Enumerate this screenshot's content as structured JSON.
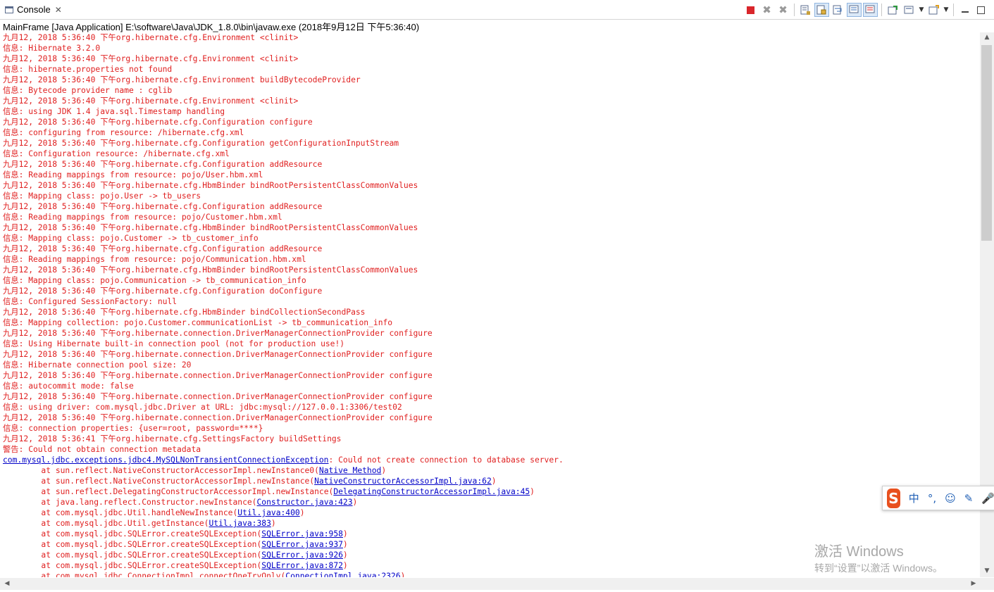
{
  "tab": {
    "label": "Console"
  },
  "process_line": "MainFrame [Java Application] E:\\software\\Java\\JDK_1.8.0\\bin\\javaw.exe (2018年9月12日 下午5:36:40)",
  "colors": {
    "error_text": "#e02020",
    "link_text": "#0000c8",
    "terminate_red": "#d9262b"
  },
  "toolbar_icons": [
    "terminate-icon",
    "remove-launch-icon",
    "remove-all-terminated-icon",
    "clear-console-icon",
    "scroll-lock-icon",
    "word-wrap-icon",
    "show-on-stdout-icon",
    "show-on-stderr-icon",
    "pin-console-icon",
    "display-selected-console-icon",
    "open-console-icon",
    "minimize-icon",
    "maximize-icon"
  ],
  "console_lines": [
    {
      "text": "九月12, 2018 5:36:40 下午org.hibernate.cfg.Environment <clinit>",
      "type": "err"
    },
    {
      "text": "信息: Hibernate 3.2.0",
      "type": "err"
    },
    {
      "text": "九月12, 2018 5:36:40 下午org.hibernate.cfg.Environment <clinit>",
      "type": "err"
    },
    {
      "text": "信息: hibernate.properties not found",
      "type": "err"
    },
    {
      "text": "九月12, 2018 5:36:40 下午org.hibernate.cfg.Environment buildBytecodeProvider",
      "type": "err"
    },
    {
      "text": "信息: Bytecode provider name : cglib",
      "type": "err"
    },
    {
      "text": "九月12, 2018 5:36:40 下午org.hibernate.cfg.Environment <clinit>",
      "type": "err"
    },
    {
      "text": "信息: using JDK 1.4 java.sql.Timestamp handling",
      "type": "err"
    },
    {
      "text": "九月12, 2018 5:36:40 下午org.hibernate.cfg.Configuration configure",
      "type": "err"
    },
    {
      "text": "信息: configuring from resource: /hibernate.cfg.xml",
      "type": "err"
    },
    {
      "text": "九月12, 2018 5:36:40 下午org.hibernate.cfg.Configuration getConfigurationInputStream",
      "type": "err"
    },
    {
      "text": "信息: Configuration resource: /hibernate.cfg.xml",
      "type": "err"
    },
    {
      "text": "九月12, 2018 5:36:40 下午org.hibernate.cfg.Configuration addResource",
      "type": "err"
    },
    {
      "text": "信息: Reading mappings from resource: pojo/User.hbm.xml",
      "type": "err"
    },
    {
      "text": "九月12, 2018 5:36:40 下午org.hibernate.cfg.HbmBinder bindRootPersistentClassCommonValues",
      "type": "err"
    },
    {
      "text": "信息: Mapping class: pojo.User -> tb_users",
      "type": "err"
    },
    {
      "text": "九月12, 2018 5:36:40 下午org.hibernate.cfg.Configuration addResource",
      "type": "err"
    },
    {
      "text": "信息: Reading mappings from resource: pojo/Customer.hbm.xml",
      "type": "err"
    },
    {
      "text": "九月12, 2018 5:36:40 下午org.hibernate.cfg.HbmBinder bindRootPersistentClassCommonValues",
      "type": "err"
    },
    {
      "text": "信息: Mapping class: pojo.Customer -> tb_customer_info",
      "type": "err"
    },
    {
      "text": "九月12, 2018 5:36:40 下午org.hibernate.cfg.Configuration addResource",
      "type": "err"
    },
    {
      "text": "信息: Reading mappings from resource: pojo/Communication.hbm.xml",
      "type": "err"
    },
    {
      "text": "九月12, 2018 5:36:40 下午org.hibernate.cfg.HbmBinder bindRootPersistentClassCommonValues",
      "type": "err"
    },
    {
      "text": "信息: Mapping class: pojo.Communication -> tb_communication_info",
      "type": "err"
    },
    {
      "text": "九月12, 2018 5:36:40 下午org.hibernate.cfg.Configuration doConfigure",
      "type": "err"
    },
    {
      "text": "信息: Configured SessionFactory: null",
      "type": "err"
    },
    {
      "text": "九月12, 2018 5:36:40 下午org.hibernate.cfg.HbmBinder bindCollectionSecondPass",
      "type": "err"
    },
    {
      "text": "信息: Mapping collection: pojo.Customer.communicationList -> tb_communication_info",
      "type": "err"
    },
    {
      "text": "九月12, 2018 5:36:40 下午org.hibernate.connection.DriverManagerConnectionProvider configure",
      "type": "err"
    },
    {
      "text": "信息: Using Hibernate built-in connection pool (not for production use!)",
      "type": "err"
    },
    {
      "text": "九月12, 2018 5:36:40 下午org.hibernate.connection.DriverManagerConnectionProvider configure",
      "type": "err"
    },
    {
      "text": "信息: Hibernate connection pool size: 20",
      "type": "err"
    },
    {
      "text": "九月12, 2018 5:36:40 下午org.hibernate.connection.DriverManagerConnectionProvider configure",
      "type": "err"
    },
    {
      "text": "信息: autocommit mode: false",
      "type": "err"
    },
    {
      "text": "九月12, 2018 5:36:40 下午org.hibernate.connection.DriverManagerConnectionProvider configure",
      "type": "err"
    },
    {
      "text": "信息: using driver: com.mysql.jdbc.Driver at URL: jdbc:mysql://127.0.0.1:3306/test02",
      "type": "err"
    },
    {
      "text": "九月12, 2018 5:36:40 下午org.hibernate.connection.DriverManagerConnectionProvider configure",
      "type": "err"
    },
    {
      "text": "信息: connection properties: {user=root, password=****}",
      "type": "err"
    },
    {
      "text": "九月12, 2018 5:36:41 下午org.hibernate.cfg.SettingsFactory buildSettings",
      "type": "err"
    },
    {
      "text": "警告: Could not obtain connection metadata",
      "type": "err"
    },
    {
      "text": "",
      "type": "exc",
      "link": "com.mysql.jdbc.exceptions.jdbc4.MySQLNonTransientConnectionException",
      "rest": ": Could not create connection to database server."
    },
    {
      "text": "",
      "type": "trace",
      "prefix": "\tat sun.reflect.NativeConstructorAccessorImpl.newInstance0(",
      "link": "Native Method",
      "suffix": ")"
    },
    {
      "text": "",
      "type": "trace",
      "prefix": "\tat sun.reflect.NativeConstructorAccessorImpl.newInstance(",
      "link": "NativeConstructorAccessorImpl.java:62",
      "suffix": ")"
    },
    {
      "text": "",
      "type": "trace",
      "prefix": "\tat sun.reflect.DelegatingConstructorAccessorImpl.newInstance(",
      "link": "DelegatingConstructorAccessorImpl.java:45",
      "suffix": ")"
    },
    {
      "text": "",
      "type": "trace",
      "prefix": "\tat java.lang.reflect.Constructor.newInstance(",
      "link": "Constructor.java:423",
      "suffix": ")"
    },
    {
      "text": "",
      "type": "trace",
      "prefix": "\tat com.mysql.jdbc.Util.handleNewInstance(",
      "link": "Util.java:400",
      "suffix": ")"
    },
    {
      "text": "",
      "type": "trace",
      "prefix": "\tat com.mysql.jdbc.Util.getInstance(",
      "link": "Util.java:383",
      "suffix": ")"
    },
    {
      "text": "",
      "type": "trace",
      "prefix": "\tat com.mysql.jdbc.SQLError.createSQLException(",
      "link": "SQLError.java:958",
      "suffix": ")"
    },
    {
      "text": "",
      "type": "trace",
      "prefix": "\tat com.mysql.jdbc.SQLError.createSQLException(",
      "link": "SQLError.java:937",
      "suffix": ")"
    },
    {
      "text": "",
      "type": "trace",
      "prefix": "\tat com.mysql.jdbc.SQLError.createSQLException(",
      "link": "SQLError.java:926",
      "suffix": ")"
    },
    {
      "text": "",
      "type": "trace",
      "prefix": "\tat com.mysql.jdbc.SQLError.createSQLException(",
      "link": "SQLError.java:872",
      "suffix": ")"
    },
    {
      "text": "",
      "type": "trace",
      "prefix": "\tat com.mysql.jdbc.ConnectionImpl.connectOneTryOnly(",
      "link": "ConnectionImpl.java:2326",
      "suffix": ")"
    }
  ],
  "ime": {
    "logo": "S",
    "items": [
      "中",
      "°,",
      "☺",
      "✎",
      "🎤"
    ]
  },
  "watermark": {
    "line1": "激活 Windows",
    "line2": "转到“设置”以激活 Windows。"
  }
}
